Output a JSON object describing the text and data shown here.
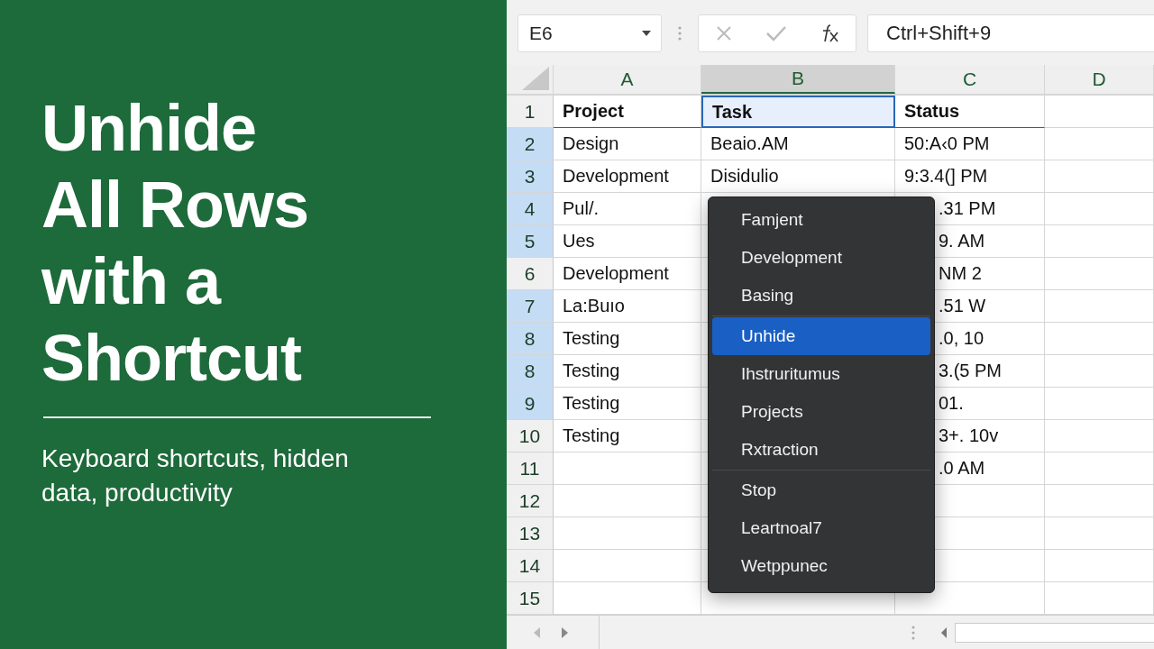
{
  "banner": {
    "title_lines": [
      "Unhide",
      "All Rows",
      "with a",
      "Shortcut"
    ],
    "subtitle": "Keyboard shortcuts, hidden data, productivity"
  },
  "formula_bar": {
    "name_box": "E6",
    "formula": "Ctrl+Shift+9"
  },
  "columns": [
    {
      "label": "A",
      "selected": false
    },
    {
      "label": "B",
      "selected": true
    },
    {
      "label": "C",
      "selected": false
    },
    {
      "label": "D",
      "selected": false
    }
  ],
  "rows": [
    {
      "label": "1",
      "selected": false,
      "header": true,
      "cells": [
        "Project",
        "Task",
        "Status"
      ]
    },
    {
      "label": "2",
      "selected": true,
      "cells": [
        "Design",
        "Beaio.AM",
        "50:A‹0 PM"
      ]
    },
    {
      "label": "3",
      "selected": true,
      "cells": [
        "Development",
        "Disidulio",
        "9:3.4(] PM"
      ]
    },
    {
      "label": "4",
      "selected": true,
      "cells": [
        "Pul/.",
        "",
        ".31 PM"
      ]
    },
    {
      "label": "5",
      "selected": true,
      "cells": [
        "Ues",
        "",
        "9. AM"
      ]
    },
    {
      "label": "6",
      "selected": false,
      "cells": [
        "Development",
        "",
        "NM 2"
      ]
    },
    {
      "label": "7",
      "selected": true,
      "cells": [
        "La:Buıo",
        "",
        ".51 W"
      ]
    },
    {
      "label": "8",
      "selected": true,
      "cells": [
        "Testing",
        "",
        ".0, 10"
      ]
    },
    {
      "label": "8",
      "selected": true,
      "cells": [
        "Testing",
        "",
        "3.(5 PM"
      ]
    },
    {
      "label": "9",
      "selected": true,
      "cells": [
        "Testing",
        "",
        "01."
      ]
    },
    {
      "label": "10",
      "selected": false,
      "cells": [
        "Testing",
        "",
        "3+. 10v"
      ]
    },
    {
      "label": "11",
      "selected": false,
      "cells": [
        "",
        "",
        ".0 AM"
      ]
    },
    {
      "label": "12",
      "selected": false,
      "cells": [
        "",
        "",
        ""
      ]
    },
    {
      "label": "13",
      "selected": false,
      "cells": [
        "",
        "",
        ""
      ]
    },
    {
      "label": "14",
      "selected": false,
      "cells": [
        "",
        "",
        ""
      ]
    },
    {
      "label": "15",
      "selected": false,
      "cells": [
        "",
        "",
        ""
      ]
    }
  ],
  "context_menu": [
    [
      {
        "label": "Famjent",
        "selected": false
      },
      {
        "label": "Development",
        "selected": false
      },
      {
        "label": "Basing",
        "selected": false
      }
    ],
    [
      {
        "label": "Unhide",
        "selected": true
      },
      {
        "label": "Ihstruritumus",
        "selected": false
      },
      {
        "label": "Projects",
        "selected": false
      },
      {
        "label": "Rxtraction",
        "selected": false
      }
    ],
    [
      {
        "label": "Stop",
        "selected": false
      },
      {
        "label": "Leartnoal7",
        "selected": false
      },
      {
        "label": "Wetppunec",
        "selected": false
      }
    ]
  ]
}
